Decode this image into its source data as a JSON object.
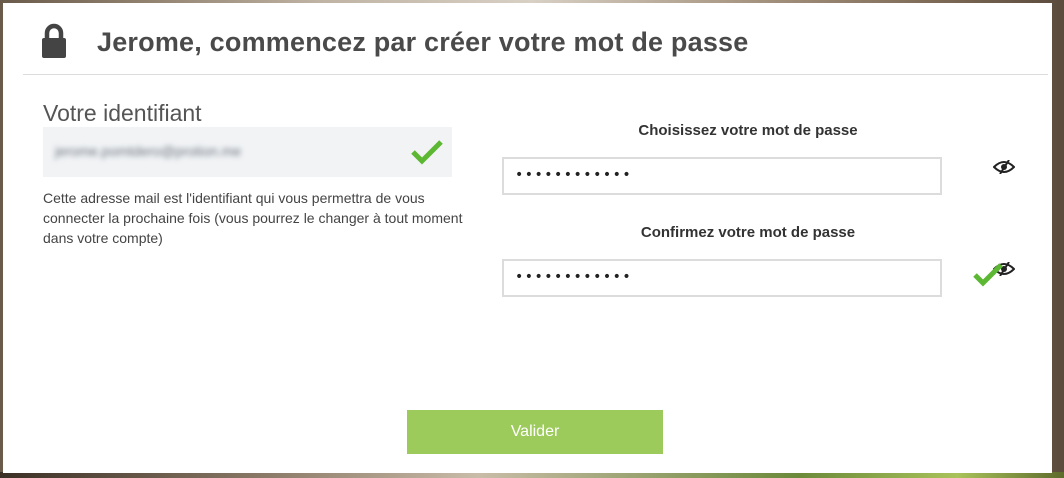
{
  "header": {
    "title": "Jerome, commencez par créer votre mot de passe"
  },
  "identifier": {
    "label": "Votre identifiant",
    "value": "jerome.pomtdero@protion.me",
    "help": "Cette adresse mail est l'identifiant qui vous permettra de vous connecter la prochaine fois (vous pourrez le changer à tout moment dans votre compte)"
  },
  "password": {
    "choose_label": "Choisissez votre mot de passe",
    "choose_value": "••••••••••••",
    "confirm_label": "Confirmez votre mot de passe",
    "confirm_value": "••••••••••••"
  },
  "actions": {
    "submit_label": "Valider"
  },
  "icons": {
    "lock": "lock-icon",
    "check": "check-icon",
    "eye": "eye-slash-icon"
  },
  "colors": {
    "accent_green": "#9ccb5c",
    "check_green": "#5cb832",
    "title_text": "#4a4a4a"
  }
}
